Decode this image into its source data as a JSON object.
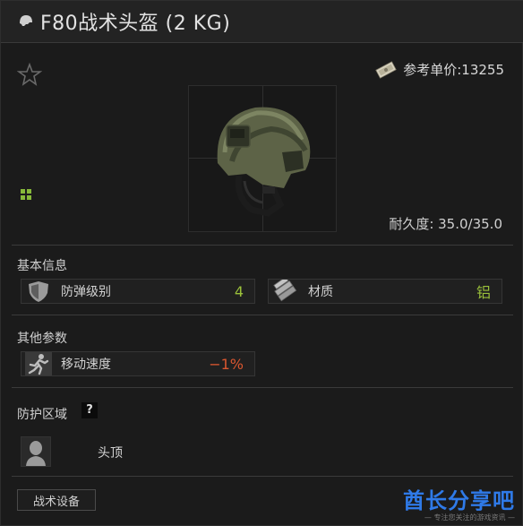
{
  "title": "F80战术头盔 (2 KG)",
  "price": {
    "label": "参考单价:13255"
  },
  "durability": "耐久度: 35.0/35.0",
  "sections": {
    "basic": {
      "title": "基本信息",
      "stats": [
        {
          "label": "防弹级别",
          "value": "4",
          "value_color": "#9ac03a",
          "icon": "armor-shield-icon"
        },
        {
          "label": "材质",
          "value": "铝",
          "value_color": "#9ac03a",
          "icon": "material-ingots-icon"
        }
      ]
    },
    "other": {
      "title": "其他参数",
      "stats": [
        {
          "label": "移动速度",
          "value": "−1%",
          "value_color": "#d9562f",
          "icon": "running-icon"
        }
      ]
    },
    "protection": {
      "title": "防护区域",
      "help": "?",
      "zone_label": "头顶"
    }
  },
  "tab": {
    "label": "战术设备"
  },
  "watermark": {
    "brand": "酋长分享吧",
    "tagline": "— 专注您关注的游戏资讯 —"
  },
  "colors": {
    "accent_green": "#9ac03a",
    "negative_red": "#d9562f",
    "watermark_blue": "#2f7ae8"
  }
}
